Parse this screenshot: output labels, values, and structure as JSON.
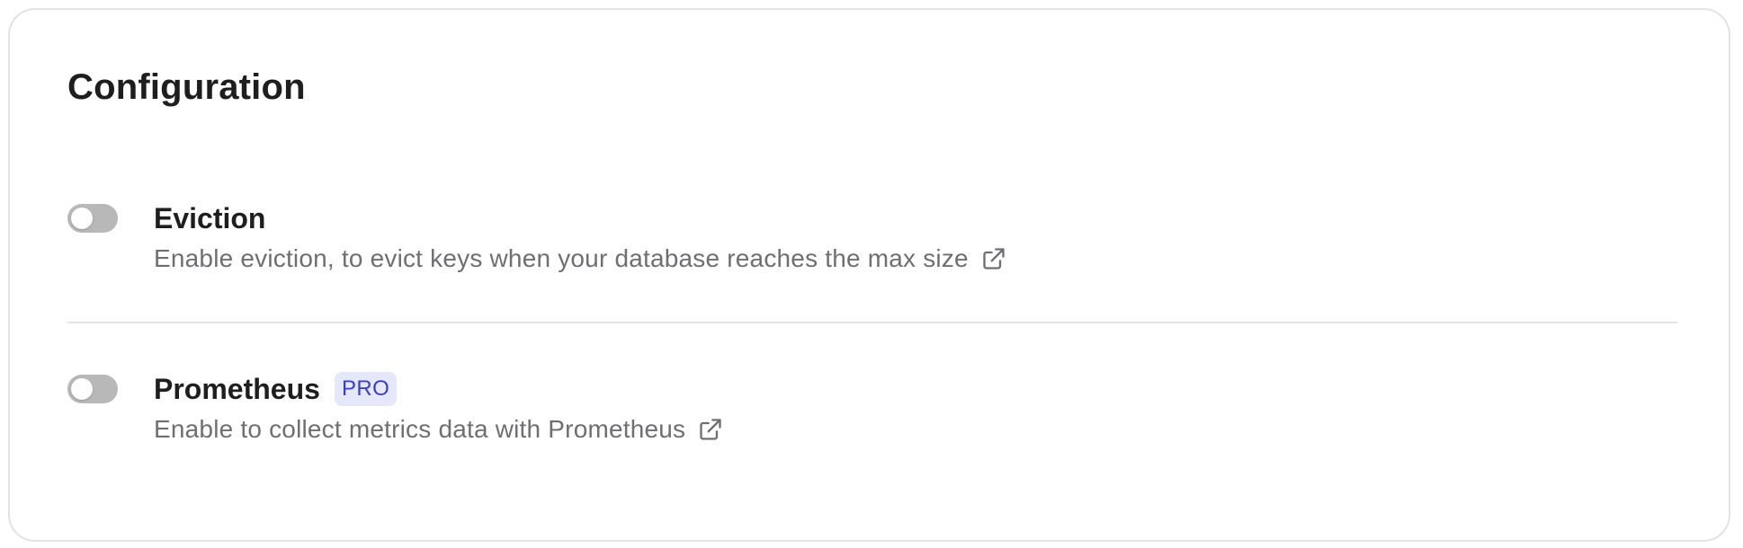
{
  "config": {
    "title": "Configuration"
  },
  "settings": [
    {
      "name": "Eviction",
      "description": "Enable eviction, to evict keys when your database reaches the max size",
      "enabled": false,
      "link_icon": "external-link-icon"
    },
    {
      "name": "Prometheus",
      "badge": "PRO",
      "description": "Enable to collect metrics data with Prometheus",
      "enabled": false,
      "link_icon": "external-link-icon"
    }
  ],
  "colors": {
    "toggle_off": "#b8b8b8",
    "badge_bg": "#e5e8fb",
    "badge_text": "#3a3ec6",
    "description_text": "#6f6f73"
  }
}
